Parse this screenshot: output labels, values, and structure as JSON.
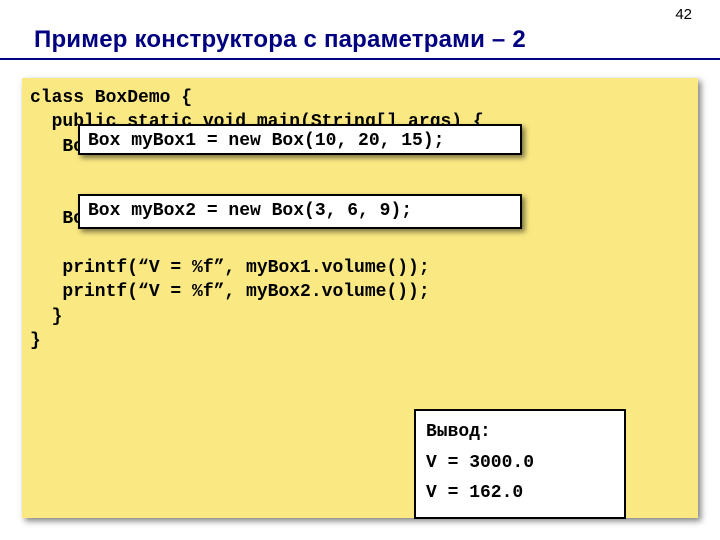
{
  "page_number": "42",
  "title": "Пример конструктора с параметрами – 2",
  "code": "class BoxDemo {\n  public static void main(String[] args) {\n   Bo\n\n\n   Bo\n\n   printf(“V = %f”, myBox1.volume());\n   printf(“V = %f”, myBox2.volume());\n  }\n}",
  "overlay1": "Box myBox1 = new Box(10, 20, 15);",
  "overlay2": "Box myBox2 = new Box(3, 6, 9);",
  "output": {
    "label": "Вывод:",
    "line1": "V = 3000.0",
    "line2": "V = 162.0"
  }
}
